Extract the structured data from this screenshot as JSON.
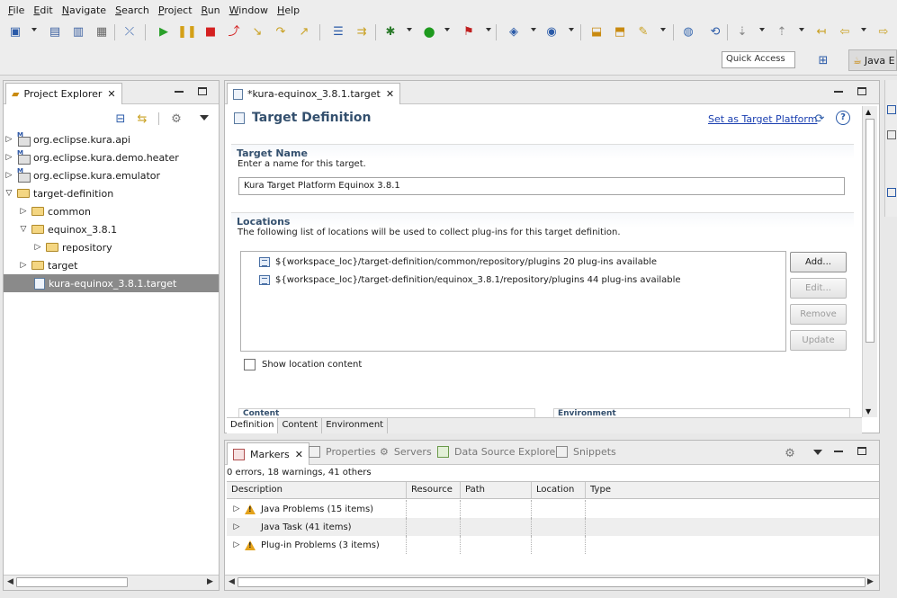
{
  "menu": [
    "File",
    "Edit",
    "Navigate",
    "Search",
    "Project",
    "Run",
    "Window",
    "Help"
  ],
  "menu_mnemonic_index": [
    0,
    0,
    0,
    0,
    0,
    0,
    0,
    0
  ],
  "quick_access": {
    "placeholder": "Quick Access"
  },
  "perspective": {
    "label": "Java E"
  },
  "explorer": {
    "tab_label": "Project Explorer",
    "items": [
      {
        "label": "org.eclipse.kura.api",
        "type": "project",
        "expanded": false
      },
      {
        "label": "org.eclipse.kura.demo.heater",
        "type": "project",
        "expanded": false
      },
      {
        "label": "org.eclipse.kura.emulator",
        "type": "project",
        "expanded": false
      },
      {
        "label": "target-definition",
        "type": "project",
        "expanded": true
      },
      {
        "label": "common",
        "type": "folder",
        "expanded": false
      },
      {
        "label": "equinox_3.8.1",
        "type": "folder",
        "expanded": true
      },
      {
        "label": "repository",
        "type": "folder",
        "expanded": false
      },
      {
        "label": "target",
        "type": "folder",
        "expanded": false
      },
      {
        "label": "kura-equinox_3.8.1.target",
        "type": "file",
        "selected": true
      }
    ]
  },
  "editor": {
    "tab_label": "*kura-equinox_3.8.1.target",
    "title": "Target Definition",
    "set_platform_link": "Set as Target Platform",
    "target_name": {
      "heading": "Target Name",
      "description": "Enter a name for this target.",
      "value": "Kura Target Platform Equinox 3.8.1"
    },
    "locations": {
      "heading": "Locations",
      "description": "The following list of locations will be used to collect plug-ins for this target definition.",
      "items": [
        "${workspace_loc}/target-definition/common/repository/plugins 20 plug-ins available",
        "${workspace_loc}/target-definition/equinox_3.8.1/repository/plugins 44 plug-ins available"
      ],
      "buttons": {
        "add": "Add...",
        "edit": "Edit...",
        "remove": "Remove",
        "update": "Update"
      }
    },
    "show_location_content": "Show location content",
    "partial_sections": [
      "Content",
      "Environment"
    ],
    "bottom_tabs": [
      "Definition",
      "Content",
      "Environment"
    ]
  },
  "markers": {
    "tabs": [
      "Markers",
      "Properties",
      "Servers",
      "Data Source Explorer",
      "Snippets"
    ],
    "summary": "0 errors, 18 warnings, 41 others",
    "columns": [
      "Description",
      "Resource",
      "Path",
      "Location",
      "Type"
    ],
    "rows": [
      {
        "label": "Java Problems (15 items)",
        "icon": "warning"
      },
      {
        "label": "Java Task (41 items)",
        "icon": "none"
      },
      {
        "label": "Plug-in Problems (3 items)",
        "icon": "warning"
      }
    ]
  },
  "colors": {
    "section_heading": "#34506e",
    "link": "#1a3fb0",
    "selection": "#8a8a8a",
    "warning": "#e4a21a"
  }
}
